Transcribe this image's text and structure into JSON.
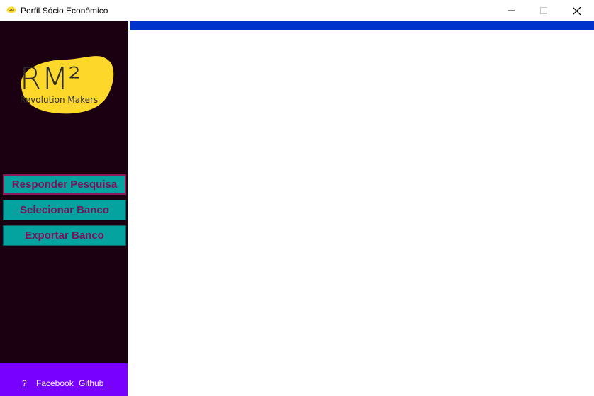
{
  "window": {
    "title": "Perfil Sócio Econômico"
  },
  "logo": {
    "brand": "RM²",
    "tagline": "Revolution Makers"
  },
  "sidebar": {
    "buttons": [
      {
        "label": "Responder Pesquisa",
        "active": true
      },
      {
        "label": "Selecionar Banco",
        "active": false
      },
      {
        "label": "Exportar Banco",
        "active": false
      }
    ]
  },
  "footer": {
    "help": "?",
    "facebook": "Facebook",
    "github": "Github"
  },
  "colors": {
    "sidebar_bg": "#1b0011",
    "button_bg": "#05a3a0",
    "button_text": "#7a1159",
    "footer_bg": "#7700ff",
    "top_bar": "#0033cc",
    "logo_yellow": "#fdd72a"
  }
}
